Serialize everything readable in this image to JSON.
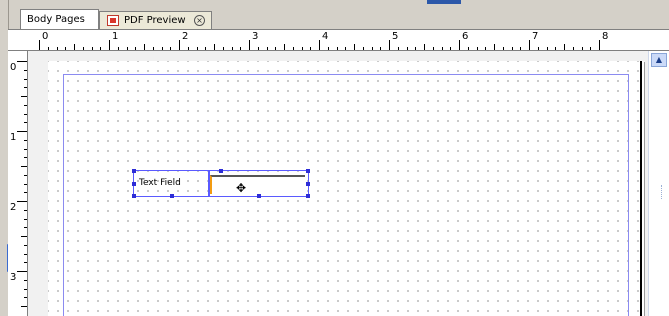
{
  "tabs": [
    {
      "label": "Body Pages",
      "active": true
    },
    {
      "label": "PDF Preview",
      "active": false
    }
  ],
  "ruler": {
    "h_numbers": [
      "0",
      "1",
      "2",
      "3",
      "4",
      "5",
      "6",
      "7",
      "8"
    ],
    "v_numbers": [
      "0",
      "1",
      "2",
      "3"
    ]
  },
  "form": {
    "label_text": "Text Field"
  },
  "icons": {
    "pdf": "pdf-file-icon",
    "close": "close-tab-icon",
    "move": "move-cursor-icon",
    "scroll_up": "scroll-up-arrow-icon"
  },
  "colors": {
    "selection": "#5a5aff",
    "handle": "#2d2dd6",
    "focus_edge": "#f39c12"
  }
}
